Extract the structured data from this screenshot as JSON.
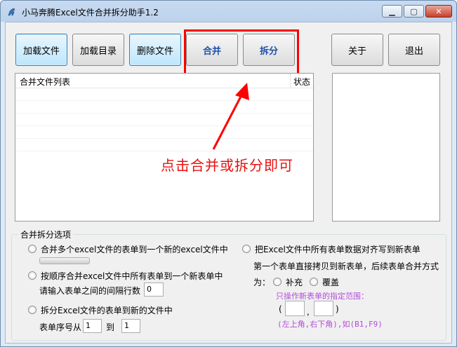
{
  "window": {
    "title": "小马奔腾Excel文件合并拆分助手1.2"
  },
  "toolbar": {
    "load_file": "加载文件",
    "load_dir": "加载目录",
    "delete_file": "删除文件",
    "merge": "合并",
    "split": "拆分",
    "about": "关于",
    "exit": "退出"
  },
  "file_list": {
    "col_name": "合并文件列表",
    "col_status": "状态"
  },
  "annotation": {
    "text": "点击合并或拆分即可"
  },
  "options": {
    "group_title": "合并拆分选项",
    "opt1_label": "合并多个excel文件的表单到一个新的excel文件中",
    "opt1_progress": 0,
    "opt2_label": "按顺序合并excel文件中所有表单到一个新表单中",
    "opt2_sub": "请输入表单之间的间隔行数",
    "opt2_value": "0",
    "opt3_label": "拆分Excel文件的表单到新的文件中",
    "opt3_from_label": "表单序号从",
    "opt3_from": "1",
    "opt3_to_label": "到",
    "opt3_to": "1",
    "opt4_label": "把Excel文件中所有表单数据对齐写到新表单",
    "opt4_desc": "第一个表单直接拷贝到新表单，后续表单合并方式",
    "opt4_mode_label": "为：",
    "opt4_mode_a": "补充",
    "opt4_mode_b": "覆盖",
    "range_hint": "只操作新表单的指定范围：",
    "range_open": "(",
    "range_comma": ",",
    "range_close": ")",
    "range_from": "",
    "range_to": "",
    "range_example": "(左上角,右下角),如(B1,F9)"
  }
}
